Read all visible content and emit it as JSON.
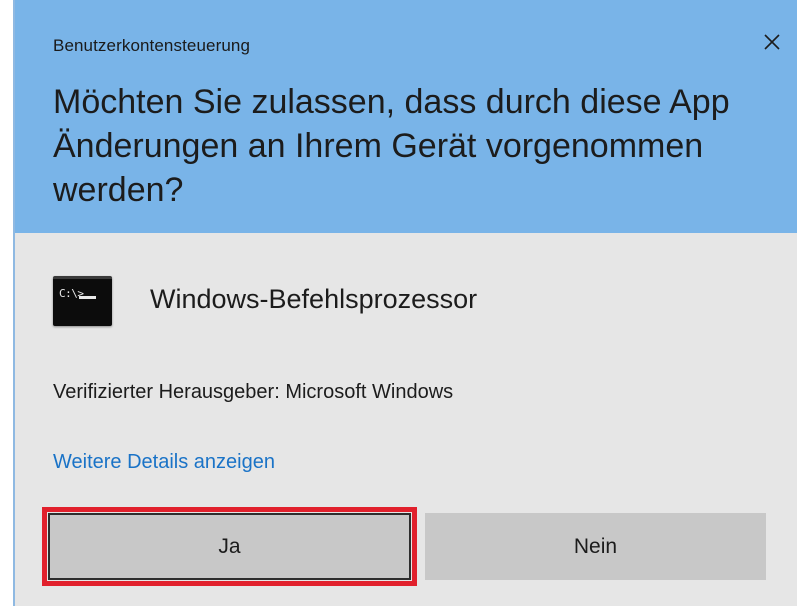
{
  "dialog": {
    "window_title": "Benutzerkontensteuerung",
    "question": "Möchten Sie zulassen, dass durch diese App Änderungen an Ihrem Gerät vorgenommen werden?",
    "close_icon": "close-icon"
  },
  "app": {
    "icon": "command-prompt-icon",
    "icon_text": "C:\\>",
    "name": "Windows-Befehlsprozessor",
    "publisher": "Verifizierter Herausgeber: Microsoft Windows",
    "details_link": "Weitere Details anzeigen"
  },
  "buttons": {
    "yes_label": "Ja",
    "no_label": "Nein"
  },
  "colors": {
    "header": "#79b4e8",
    "body": "#e6e6e6",
    "link": "#1a73c7",
    "highlight": "#e1202c"
  }
}
